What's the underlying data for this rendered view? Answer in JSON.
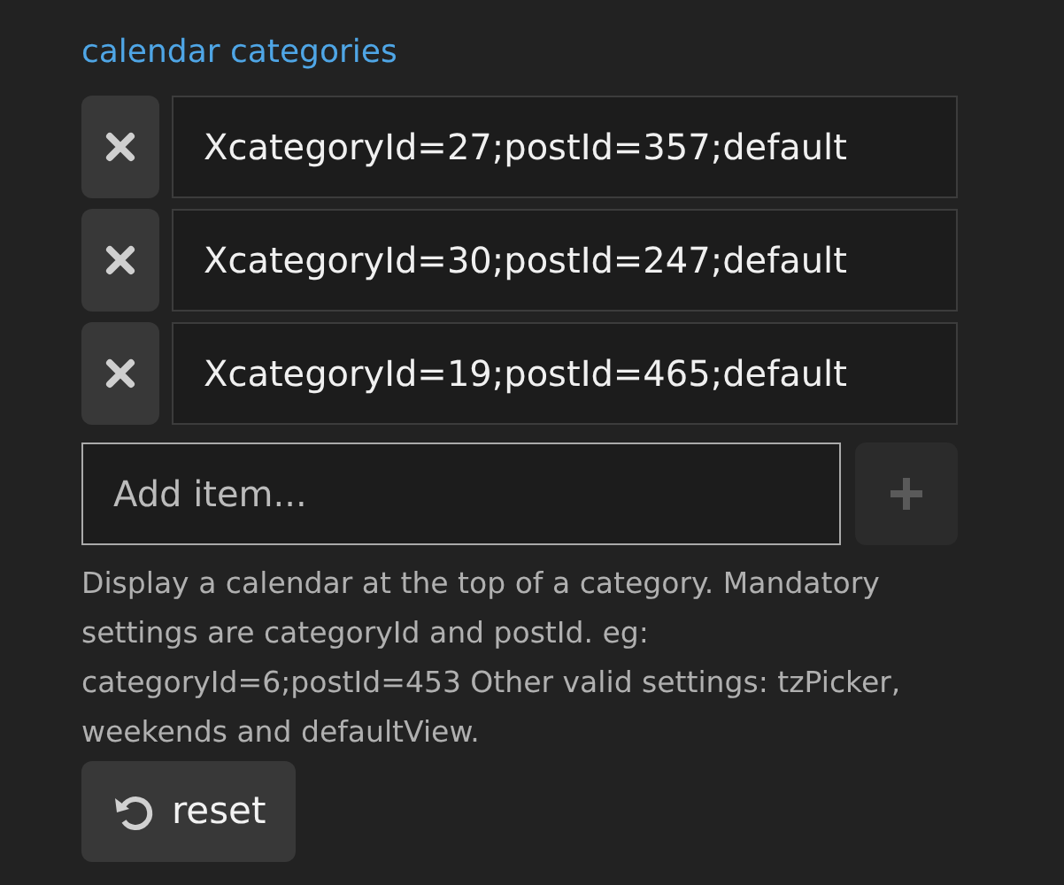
{
  "setting": {
    "title": "calendar categories",
    "items": [
      {
        "value": "XcategoryId=27;postId=357;default"
      },
      {
        "value": "XcategoryId=30;postId=247;default"
      },
      {
        "value": "XcategoryId=19;postId=465;default"
      }
    ],
    "new_item": {
      "placeholder": "Add item...",
      "add_disabled": true
    },
    "description": "Display a calendar at the top of a category. Mandatory settings are categoryId and postId. eg: categoryId=6;postId=453 Other valid settings: tzPicker, weekends and defaultView.",
    "reset_button": "reset"
  }
}
